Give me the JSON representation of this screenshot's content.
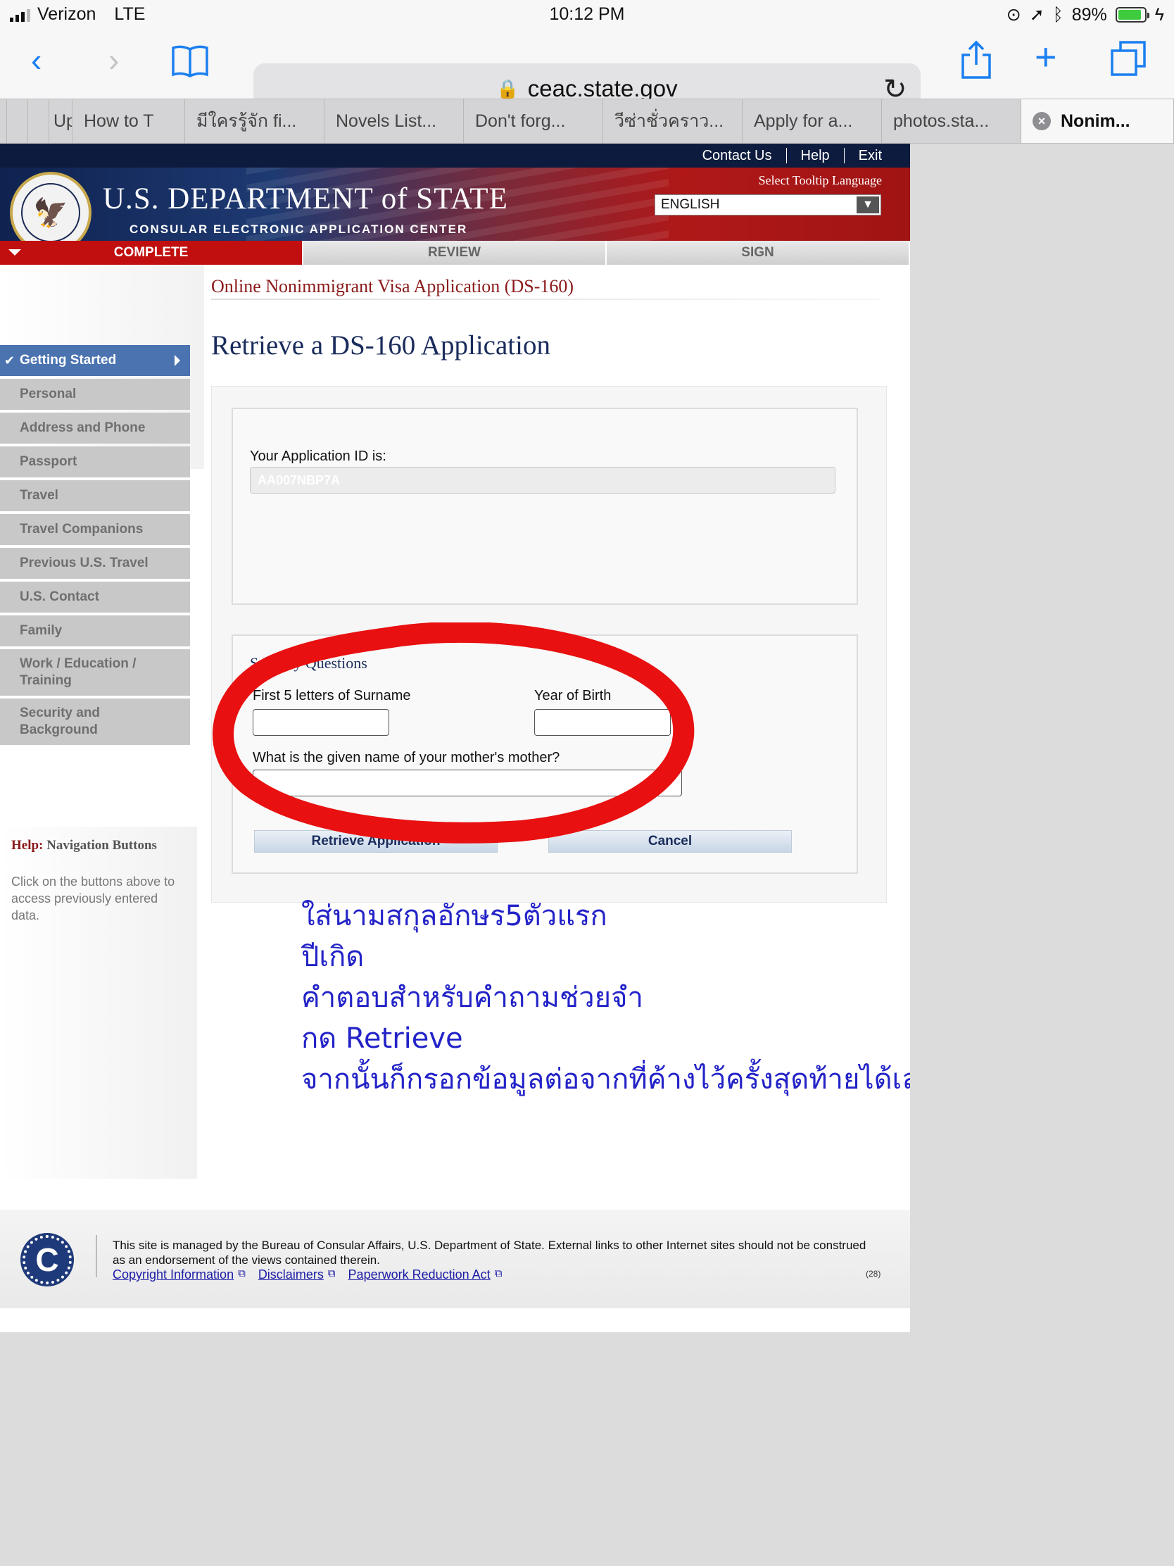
{
  "status_bar": {
    "carrier": "Verizon",
    "network": "LTE",
    "time": "10:12 PM",
    "battery": "89%",
    "battery_level": 0.89
  },
  "browser": {
    "url": "ceac.state.gov",
    "tabs": [
      "",
      "",
      "Up",
      "How to T",
      "มีใครรู้จัก fi...",
      "Novels List...",
      "Don't forg...",
      "วีซ่าชั่วคราว...",
      "Apply for a...",
      "photos.sta...",
      "Nonim..."
    ],
    "active_tab_index": 10
  },
  "header": {
    "contact_us": "Contact Us",
    "help": "Help",
    "exit": "Exit",
    "department": "U.S. DEPARTMENT of STATE",
    "subtitle": "CONSULAR ELECTRONIC APPLICATION CENTER",
    "tooltip_label": "Select Tooltip Language",
    "language": "ENGLISH"
  },
  "steps": [
    "COMPLETE",
    "REVIEW",
    "SIGN"
  ],
  "form_title": "Online Nonimmigrant Visa Application (DS-160)",
  "sidebar": {
    "items": [
      {
        "label": "Getting Started"
      },
      {
        "label": "Personal"
      },
      {
        "label": "Address and Phone"
      },
      {
        "label": "Passport"
      },
      {
        "label": "Travel"
      },
      {
        "label": "Travel Companions"
      },
      {
        "label": "Previous U.S. Travel"
      },
      {
        "label": "U.S. Contact"
      },
      {
        "label": "Family"
      },
      {
        "label": "Work / Education / Training"
      },
      {
        "label": "Security and Background"
      }
    ],
    "help_prefix": "Help:",
    "help_title": "Navigation Buttons",
    "help_text": "Click on the buttons above to access previously entered data."
  },
  "main": {
    "page_title": "Retrieve a DS-160 Application",
    "app_id_label": "Your Application ID is:",
    "app_id_value": "AA007NBP7A",
    "security_title": "Security Questions",
    "surname_label": "First 5 letters of Surname",
    "birth_label": "Year of Birth",
    "mother_label": "What is the given name of your mother's mother?",
    "retrieve_button": "Retrieve Application",
    "cancel_button": "Cancel"
  },
  "annotation": {
    "color": "#2323c8",
    "circle_color": "#e81010",
    "lines": [
      "ใส่นามสกุลอักษร5ตัวแรก",
      "ปีเกิด",
      "คำตอบสำหรับคำถามช่วยจำ",
      "กด Retrieve",
      "จากนั้นก็กรอกข้อมูลต่อจากที่ค้างไว้ครั้งสุดท้ายได้เลย"
    ]
  },
  "footer": {
    "text": "This site is managed by the Bureau of Consular Affairs, U.S. Department of State. External links to other Internet sites should not be construed as an endorsement of the views contained therein.",
    "links": [
      "Copyright Information",
      "Disclaimers",
      "Paperwork Reduction Act"
    ],
    "code": "(28)"
  }
}
